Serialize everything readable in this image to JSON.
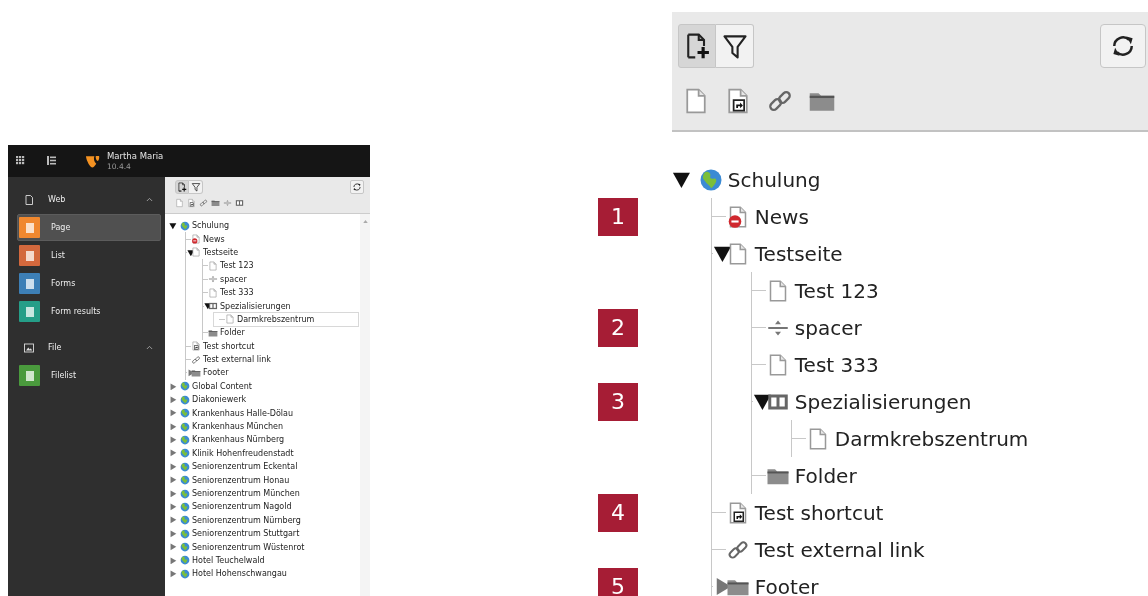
{
  "topbar": {
    "site_name": "Martha Maria",
    "version": "10.4.4"
  },
  "module_menu": [
    {
      "label": "Web",
      "kind": "web",
      "expanded": true,
      "items": [
        {
          "label": "Page",
          "selected": true,
          "color": "#f0882f"
        },
        {
          "label": "List",
          "selected": false,
          "color": "#d3683d"
        },
        {
          "label": "Forms",
          "selected": false,
          "color": "#3d7fb6"
        },
        {
          "label": "Form results",
          "selected": false,
          "color": "#259e88"
        }
      ]
    },
    {
      "label": "File",
      "kind": "file",
      "expanded": true,
      "items": [
        {
          "label": "Filelist",
          "selected": false,
          "color": "#4a9a3d"
        }
      ]
    }
  ],
  "page_tree": {
    "buttons": [
      {
        "kind": "new-page",
        "selected": true
      },
      {
        "kind": "filter",
        "selected": false
      }
    ],
    "drag_items": [
      {
        "kind": "page"
      },
      {
        "kind": "shortcut"
      },
      {
        "kind": "link"
      },
      {
        "kind": "folder"
      },
      {
        "kind": "spacer"
      },
      {
        "kind": "section"
      }
    ],
    "nodes": [
      {
        "label": "Schulung",
        "kind": "site",
        "expanded": true,
        "selected": false,
        "children": [
          {
            "label": "News",
            "kind": "page-hidden",
            "selected": false
          },
          {
            "label": "Testseite",
            "kind": "page",
            "expanded": true,
            "selected": false,
            "children": [
              {
                "label": "Test 123",
                "kind": "page",
                "selected": false
              },
              {
                "label": "spacer",
                "kind": "spacer",
                "selected": false
              },
              {
                "label": "Test 333",
                "kind": "page",
                "selected": false
              },
              {
                "label": "Spezialisierungen",
                "kind": "section",
                "expanded": true,
                "selected": false,
                "children": [
                  {
                    "label": "Darmkrebszentrum",
                    "kind": "page",
                    "selected": true
                  }
                ]
              },
              {
                "label": "Folder",
                "kind": "folder",
                "selected": false
              }
            ]
          },
          {
            "label": "Test shortcut",
            "kind": "shortcut",
            "selected": false
          },
          {
            "label": "Test external link",
            "kind": "link",
            "selected": false
          },
          {
            "label": "Footer",
            "kind": "folder",
            "expanded": false,
            "selected": false
          }
        ]
      },
      {
        "label": "Global Content",
        "kind": "site",
        "expanded": false,
        "selected": false
      },
      {
        "label": "Diakoniewerk",
        "kind": "site",
        "expanded": false,
        "selected": false
      },
      {
        "label": "Krankenhaus Halle-Dölau",
        "kind": "site",
        "expanded": false,
        "selected": false
      },
      {
        "label": "Krankenhaus München",
        "kind": "site",
        "expanded": false,
        "selected": false
      },
      {
        "label": "Krankenhaus Nürnberg",
        "kind": "site",
        "expanded": false,
        "selected": false
      },
      {
        "label": "Klinik Hohenfreudenstadt",
        "kind": "site",
        "expanded": false,
        "selected": false
      },
      {
        "label": "Seniorenzentrum Eckental",
        "kind": "site",
        "expanded": false,
        "selected": false
      },
      {
        "label": "Seniorenzentrum Honau",
        "kind": "site",
        "expanded": false,
        "selected": false
      },
      {
        "label": "Seniorenzentrum München",
        "kind": "site",
        "expanded": false,
        "selected": false
      },
      {
        "label": "Seniorenzentrum Nagold",
        "kind": "site",
        "expanded": false,
        "selected": false
      },
      {
        "label": "Seniorenzentrum Nürnberg",
        "kind": "site",
        "expanded": false,
        "selected": false
      },
      {
        "label": "Seniorenzentrum Stuttgart",
        "kind": "site",
        "expanded": false,
        "selected": false
      },
      {
        "label": "Seniorenzentrum Wüstenrot",
        "kind": "site",
        "expanded": false,
        "selected": false
      },
      {
        "label": "Hotel Teuchelwald",
        "kind": "site",
        "expanded": false,
        "selected": false
      },
      {
        "label": "Hotel Hohenschwangau",
        "kind": "site",
        "expanded": false,
        "selected": false
      }
    ]
  },
  "zoomed_tree": {
    "buttons": [
      {
        "kind": "new-page",
        "selected": true
      },
      {
        "kind": "filter",
        "selected": false
      }
    ],
    "drag_items": [
      {
        "kind": "page"
      },
      {
        "kind": "shortcut"
      },
      {
        "kind": "link"
      },
      {
        "kind": "folder"
      }
    ],
    "nodes": [
      {
        "label": "Schulung",
        "kind": "site",
        "expanded": true,
        "children": [
          {
            "label": "News",
            "kind": "page-hidden",
            "badge": "1"
          },
          {
            "label": "Testseite",
            "kind": "page",
            "expanded": true,
            "children": [
              {
                "label": "Test 123",
                "kind": "page"
              },
              {
                "label": "spacer",
                "kind": "spacer",
                "badge": "2"
              },
              {
                "label": "Test 333",
                "kind": "page"
              },
              {
                "label": "Spezialisierungen",
                "kind": "section",
                "expanded": true,
                "badge": "3",
                "children": [
                  {
                    "label": "Darmkrebszentrum",
                    "kind": "page"
                  }
                ]
              },
              {
                "label": "Folder",
                "kind": "folder"
              }
            ]
          },
          {
            "label": "Test shortcut",
            "kind": "shortcut",
            "badge": "4"
          },
          {
            "label": "Test external link",
            "kind": "link"
          },
          {
            "label": "Footer",
            "kind": "folder",
            "expanded": false,
            "badge": "5"
          }
        ]
      }
    ]
  }
}
